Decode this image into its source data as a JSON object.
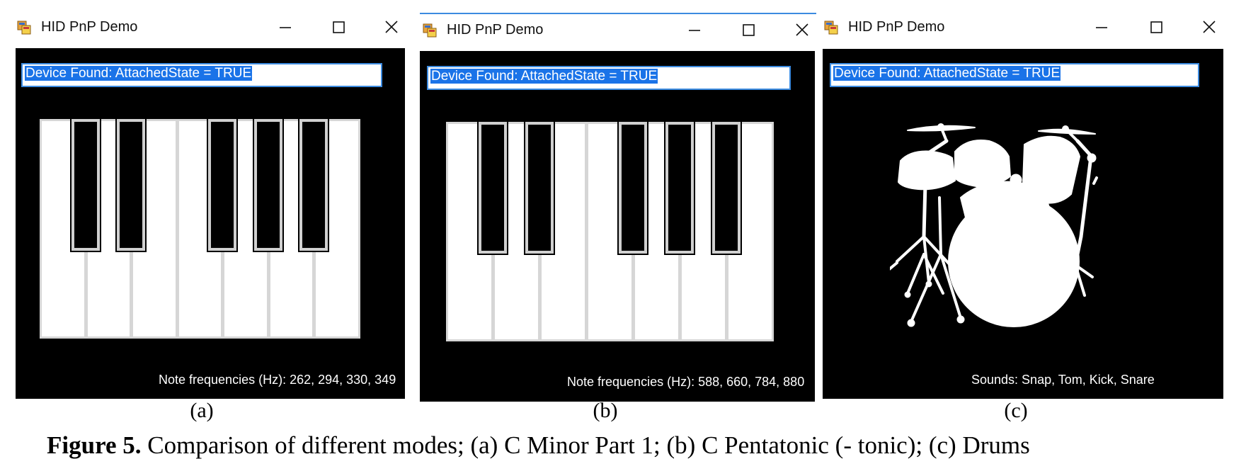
{
  "windows": [
    {
      "id": "a",
      "title": "HID PnP Demo",
      "status": "Device Found: AttachedState = TRUE",
      "mode": "piano",
      "info": "Note frequencies (Hz): 262, 294, 330, 349",
      "sublabel": "(a)"
    },
    {
      "id": "b",
      "title": "HID PnP Demo",
      "status": "Device Found: AttachedState = TRUE",
      "mode": "piano",
      "info": "Note frequencies (Hz): 588, 660, 784, 880",
      "sublabel": "(b)"
    },
    {
      "id": "c",
      "title": "HID PnP Demo",
      "status": "Device Found: AttachedState = TRUE",
      "mode": "drums",
      "info": "Sounds: Snap, Tom, Kick, Snare",
      "sublabel": "(c)"
    }
  ],
  "caption": {
    "label": "Figure 5.",
    "text": " Comparison of different modes; (a) C Minor Part 1; (b) C Pentatonic (- tonic); (c) Drums"
  },
  "icons": {
    "app": "app-window-icon",
    "minimize": "minimize-icon",
    "maximize": "maximize-icon",
    "close": "close-icon",
    "drums": "drum-kit-icon"
  },
  "colors": {
    "client_background": "#000000",
    "status_highlight": "#1a73e8",
    "status_border": "#3c8be0"
  }
}
